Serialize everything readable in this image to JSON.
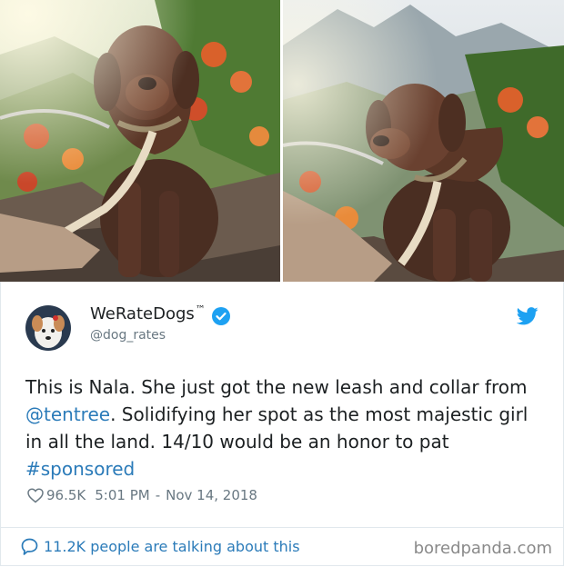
{
  "photos": [
    {
      "name": "photo-left"
    },
    {
      "name": "photo-right"
    }
  ],
  "tweet": {
    "display_name": "WeRateDogs",
    "trademark": "™",
    "handle": "@dog_rates",
    "text_1": "This is Nala. She just got the new leash and collar from ",
    "mention": "@tentree",
    "text_2": ". Solidifying her spot as the most majestic girl in all the land. 14/10 would be an honor to pat ",
    "hashtag": "#sponsored",
    "likes": "96.5K",
    "time": "5:01 PM",
    "separator": "-",
    "date": "Nov 14, 2018",
    "talking": "11.2K people are talking about this"
  },
  "watermark": "boredpanda.com",
  "colors": {
    "link": "#2b7bb9",
    "muted": "#697882",
    "verified": "#1da1f2",
    "twitter": "#1da1f2"
  },
  "icons": [
    "verified-badge-icon",
    "twitter-bird-icon",
    "heart-icon",
    "speech-bubble-icon"
  ]
}
